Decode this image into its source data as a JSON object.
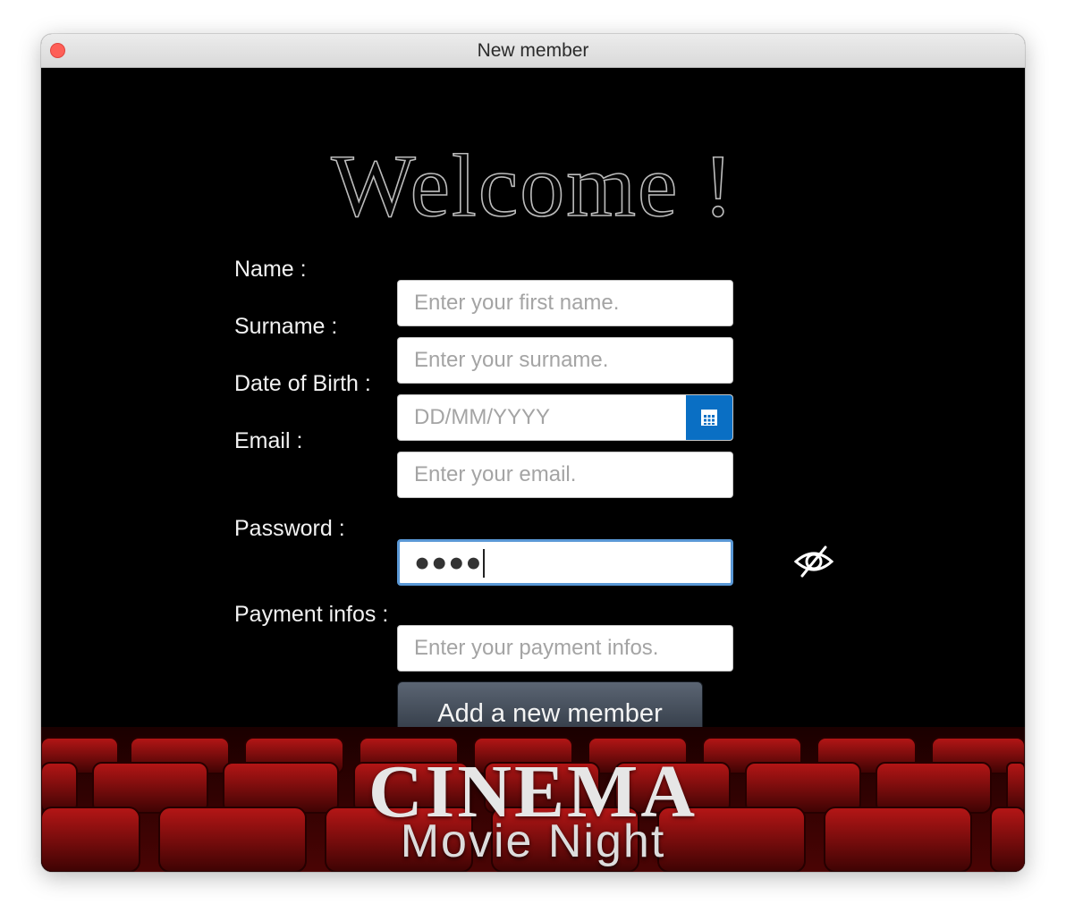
{
  "window": {
    "title": "New member"
  },
  "form": {
    "welcome": "Welcome !",
    "name": {
      "label": "Name :",
      "placeholder": "Enter your first name."
    },
    "surname": {
      "label": "Surname :",
      "placeholder": "Enter your surname."
    },
    "dob": {
      "label": "Date of Birth :",
      "placeholder": "DD/MM/YYYY"
    },
    "email": {
      "label": "Email :",
      "placeholder": "Enter your email."
    },
    "password": {
      "label": "Password :",
      "value": "●●●●"
    },
    "payment": {
      "label": "Payment infos :",
      "placeholder": "Enter your payment infos."
    },
    "submit_label": "Add a new member"
  },
  "banner": {
    "title": "CINEMA",
    "subtitle": "Movie Night"
  },
  "icons": {
    "calendar": "calendar-icon",
    "toggle_visibility": "eye-slash-icon"
  },
  "colors": {
    "background": "#000000",
    "calendar_button": "#0a6fc4",
    "focus_border": "#5a98d6",
    "seat_red": "#9c0d0d"
  }
}
